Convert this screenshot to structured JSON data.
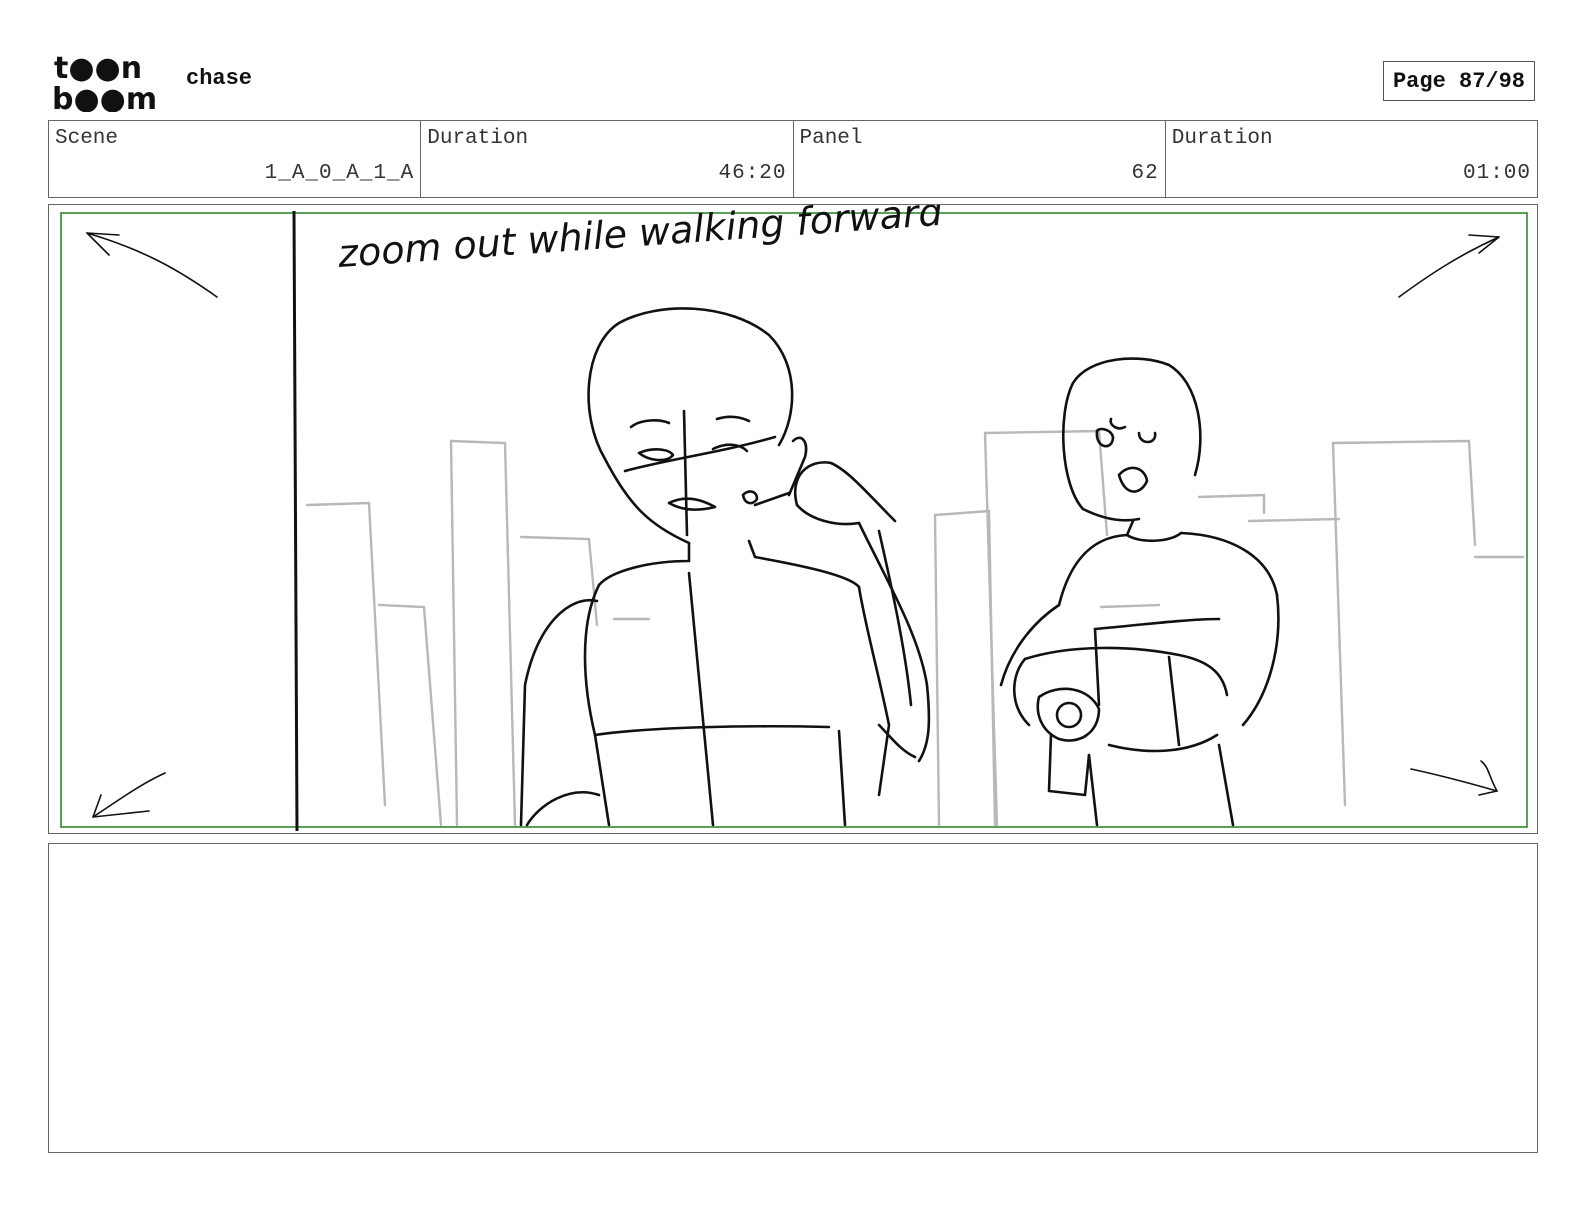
{
  "header": {
    "logo_top": "t●●n",
    "logo_bottom": "b●●m",
    "project_title": "chase",
    "page_label": "Page 87/98"
  },
  "info": {
    "scene_label": "Scene",
    "scene_value": "1_A_0_A_1_A",
    "duration_label": "Duration",
    "duration_value": "46:20",
    "panel_label": "Panel",
    "panel_value": "62",
    "panel_duration_label": "Duration",
    "panel_duration_value": "01:00"
  },
  "panel": {
    "annotation": "zoom out while walking forward",
    "safe_frame_color": "#2e8b2e"
  },
  "notes": {
    "text": ""
  }
}
